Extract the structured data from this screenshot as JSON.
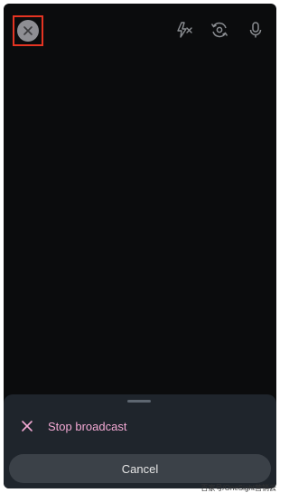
{
  "top_bar": {
    "close_icon": "close-icon",
    "icons": [
      "flash-off-icon",
      "flip-camera-icon",
      "microphone-icon"
    ]
  },
  "bottom_sheet": {
    "stop_label": "Stop broadcast",
    "cancel_label": "Cancel"
  },
  "watermark": "百家号/OneSight营销云",
  "colors": {
    "accent_pink": "#f3a9d4",
    "highlight_red": "#e53422",
    "sheet_bg": "#1f252c"
  }
}
